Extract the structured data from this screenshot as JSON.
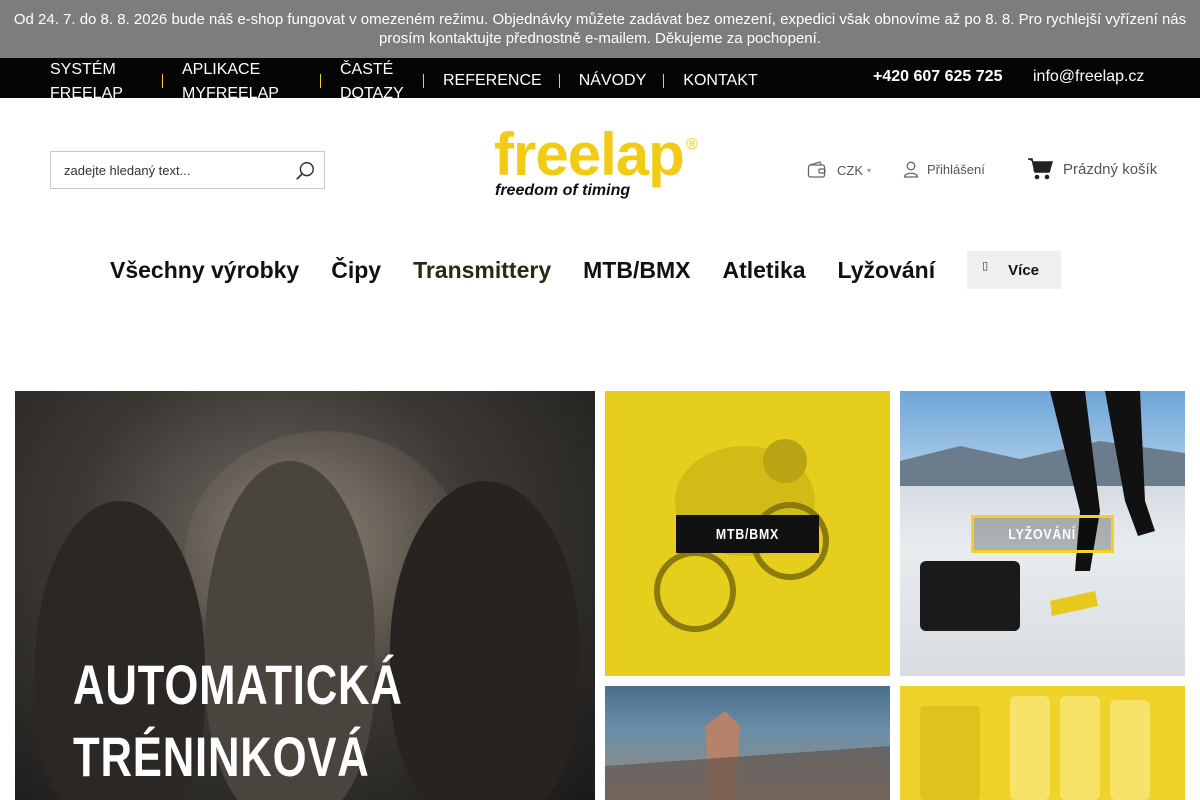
{
  "notice": {
    "text": "Od 24. 7. do 8. 8. 2026 bude náš e-shop fungovat v omezeném režimu. Objednávky můžete zadávat bez omezení, expedici však obnovíme až po 8. 8. Pro rychlejší vyřízení nás prosím kontaktujte přednostně e-mailem. Děkujeme za pochopení."
  },
  "topbar": {
    "nav": [
      "Systém Freelap",
      "Aplikace MyFreelap",
      "Časté dotazy",
      "Reference",
      "Návody",
      "Kontakt"
    ],
    "phone": "+420 607 625 725",
    "email": "info@freelap.cz"
  },
  "header": {
    "search_placeholder": "zadejte hledaný text...",
    "logo_word": "freelap",
    "logo_reg": "®",
    "logo_tagline": "freedom of timing",
    "currency": "CZK",
    "login": "Přihlášení",
    "cart": "Prázdný košík"
  },
  "mainnav": {
    "items": [
      "Všechny výrobky",
      "Čipy",
      "Transmittery",
      "MTB/BMX",
      "Atletika",
      "Lyžování"
    ],
    "active_index": 2,
    "more": "Více"
  },
  "tiles": {
    "hero_text": "AUTOMATICKÁ TRÉNINKOVÁ",
    "hero_line1": "AUTOMATICKÁ",
    "hero_line2": "TRÉNINKOVÁ",
    "mtb_label": "MTB/BMX",
    "ski_label": "LYŽOVÁNÍ"
  },
  "colors": {
    "accent_yellow": "#f2cc14",
    "notice_bg": "#7d7d7d",
    "topbar_bg": "#050505"
  }
}
